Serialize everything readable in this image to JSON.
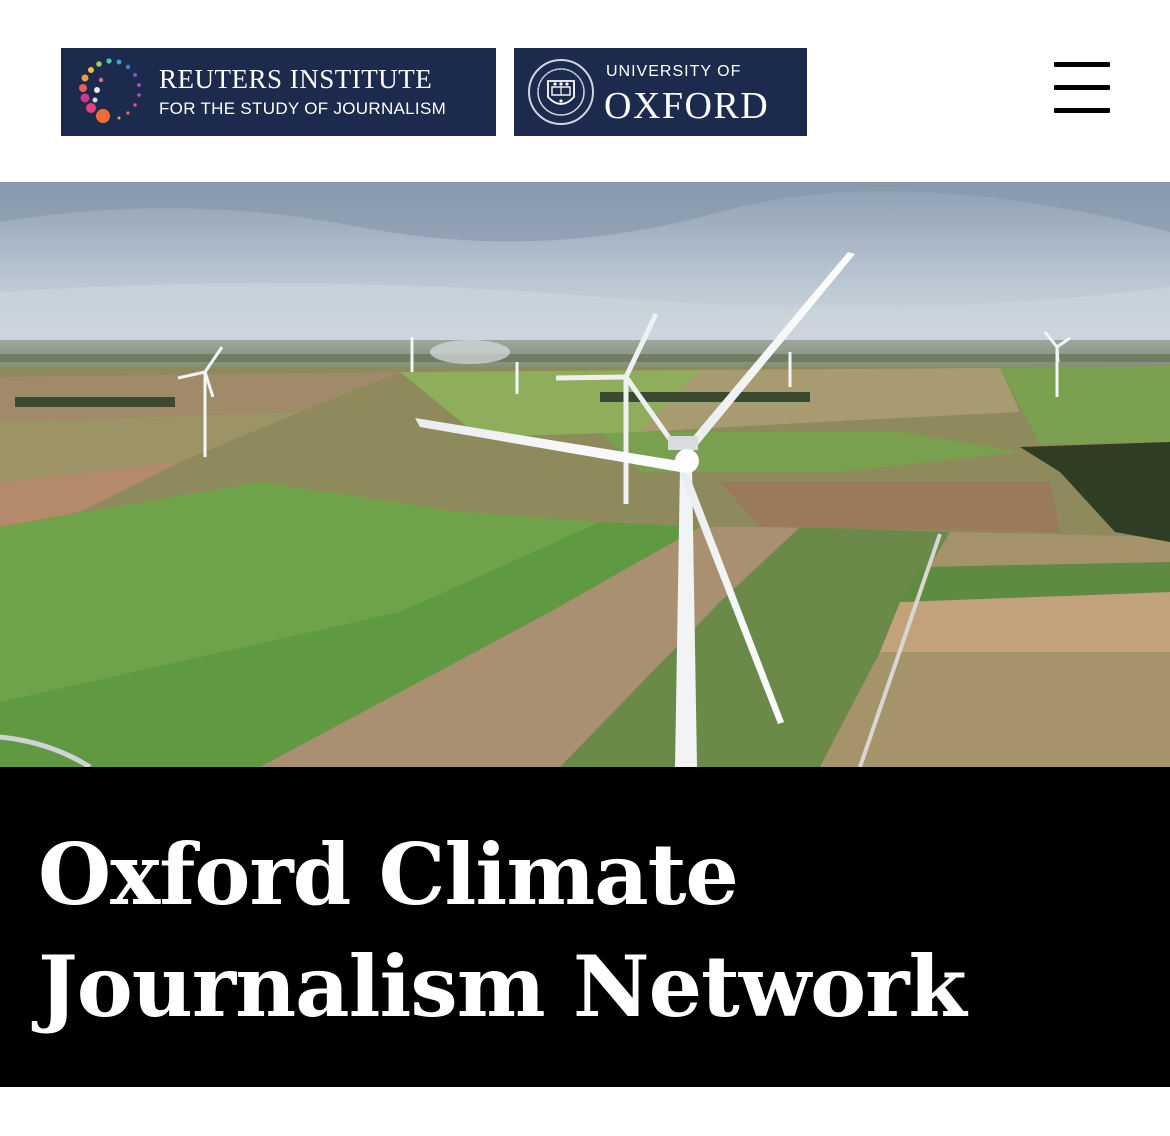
{
  "header": {
    "reuters_logo": {
      "title": "REUTERS INSTITUTE",
      "subtitle": "FOR THE STUDY OF JOURNALISM"
    },
    "oxford_logo": {
      "top": "UNIVERSITY OF",
      "main": "OXFORD"
    },
    "menu_icon": "hamburger-menu-icon"
  },
  "hero": {
    "image_subject": "aerial view of wind turbines over farmland"
  },
  "title": {
    "line1": "Oxford Climate",
    "line2": "Journalism Network"
  },
  "colors": {
    "logo_background": "#1b2a4d",
    "title_band": "#000000",
    "title_text": "#ffffff"
  }
}
